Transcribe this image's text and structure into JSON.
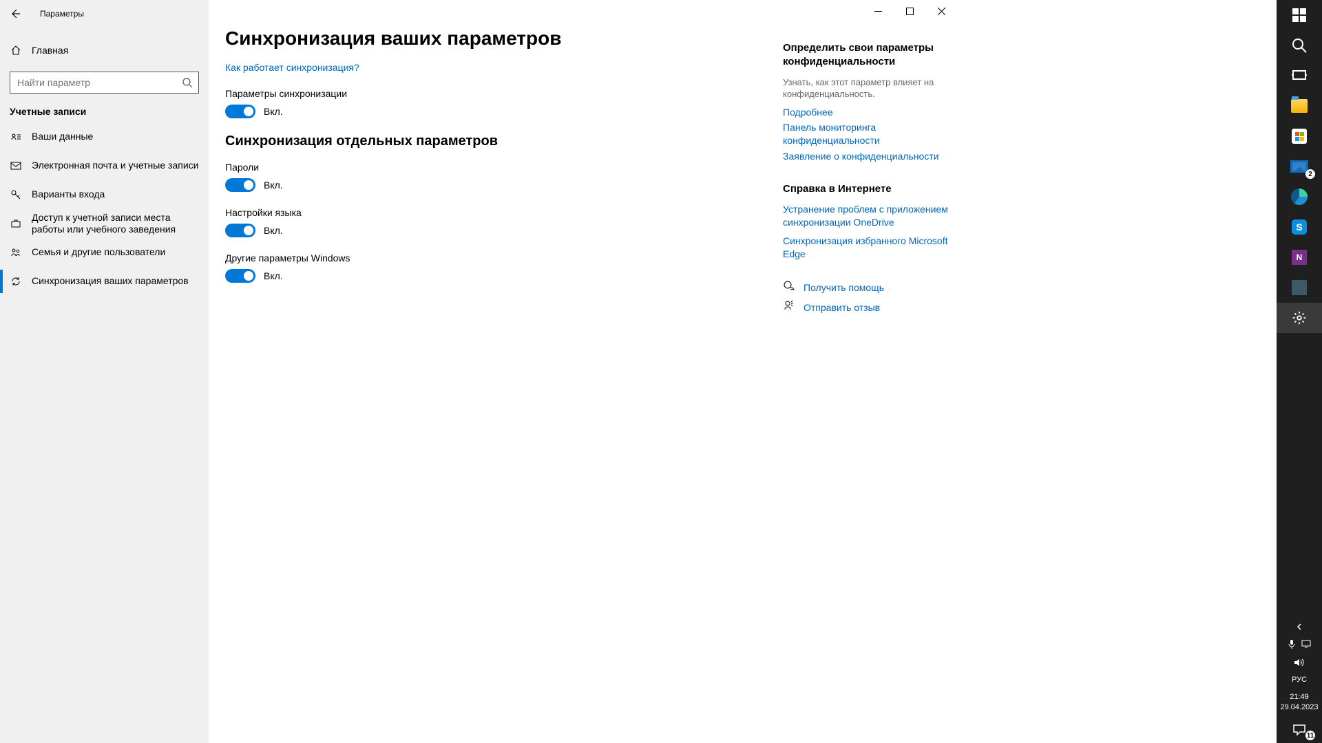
{
  "titlebar": {
    "title": "Параметры"
  },
  "home": {
    "label": "Главная"
  },
  "search": {
    "placeholder": "Найти параметр"
  },
  "sidebar": {
    "section": "Учетные записи",
    "items": [
      {
        "label": "Ваши данные"
      },
      {
        "label": "Электронная почта и учетные записи"
      },
      {
        "label": "Варианты входа"
      },
      {
        "label": "Доступ к учетной записи места работы или учебного заведения"
      },
      {
        "label": "Семья и другие пользователи"
      },
      {
        "label": "Синхронизация ваших параметров"
      }
    ]
  },
  "page": {
    "title": "Синхронизация ваших параметров",
    "how_link": "Как работает синхронизация?",
    "sync_settings_label": "Параметры синхронизации",
    "on_text": "Вкл.",
    "sub_title": "Синхронизация отдельных параметров",
    "toggles": [
      {
        "label": "Пароли",
        "state": "Вкл."
      },
      {
        "label": "Настройки языка",
        "state": "Вкл."
      },
      {
        "label": "Другие параметры Windows",
        "state": "Вкл."
      }
    ]
  },
  "rside": {
    "privacy_title": "Определить свои параметры конфиденциальности",
    "privacy_desc": "Узнать, как этот параметр влияет на конфиденциальность.",
    "privacy_links": [
      "Подробнее",
      "Панель мониторинга конфиденциальности",
      "Заявление о конфиденциальности"
    ],
    "help_title": "Справка в Интернете",
    "help_links": [
      "Устранение проблем с приложением синхронизации OneDrive",
      "Синхронизация избранного Microsoft Edge"
    ],
    "get_help": "Получить помощь",
    "feedback": "Отправить отзыв"
  },
  "taskbar": {
    "mail_badge": "2",
    "notif_badge": "11",
    "lang": "РУС",
    "time": "21:49",
    "date": "29.04.2023"
  }
}
